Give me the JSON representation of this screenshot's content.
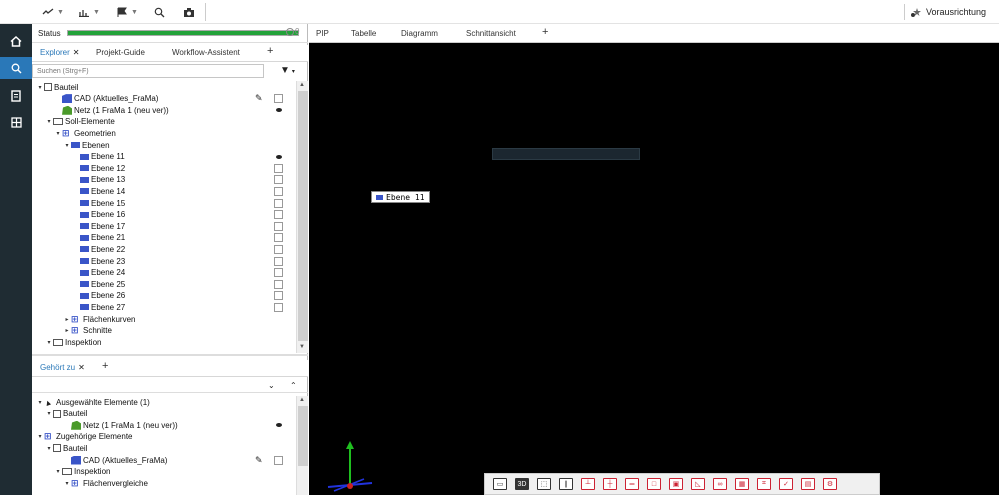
{
  "toolbar": {
    "buttons": [
      {
        "icon": "curve-icon"
      },
      {
        "icon": "chart-icon"
      },
      {
        "icon": "flag-icon"
      },
      {
        "icon": "search-icon"
      },
      {
        "icon": "camera-icon"
      }
    ],
    "align_label": "Vorausrichtung"
  },
  "leftbar": {
    "items": [
      {
        "icon": "home-icon"
      },
      {
        "icon": "search-icon",
        "active": true
      },
      {
        "icon": "document-icon"
      },
      {
        "icon": "grid-icon"
      }
    ]
  },
  "panel": {
    "status_label": "Status",
    "status_progress": 1.0,
    "status_count": "0",
    "tabs": [
      {
        "label": "Explorer",
        "selected": true,
        "closable": true
      },
      {
        "label": "Projekt-Guide"
      },
      {
        "label": "Workflow-Assistent"
      }
    ],
    "add_tab": "+",
    "search_placeholder": "Suchen (Strg+F)",
    "tree": [
      {
        "label": "Bauteil",
        "indent": 0,
        "icon": "box",
        "exp": "▾"
      },
      {
        "label": "CAD (Aktuelles_FraMa)",
        "indent": 2,
        "icon": "cad",
        "pencil": true,
        "check": "box"
      },
      {
        "label": "Netz (1 FraMa 1 (neu ver))",
        "indent": 2,
        "icon": "mesh",
        "check": "eye"
      },
      {
        "label": "Soll-Elemente",
        "indent": 1,
        "icon": "folder",
        "exp": "▾"
      },
      {
        "label": "Geometrien",
        "indent": 2,
        "icon": "geo",
        "exp": "▾"
      },
      {
        "label": "Ebenen",
        "indent": 3,
        "icon": "plane",
        "exp": "▾"
      },
      {
        "label": "Ebene 11",
        "indent": 4,
        "icon": "plane",
        "check": "eye"
      },
      {
        "label": "Ebene 12",
        "indent": 4,
        "icon": "plane",
        "check": "box"
      },
      {
        "label": "Ebene 13",
        "indent": 4,
        "icon": "plane",
        "check": "box"
      },
      {
        "label": "Ebene 14",
        "indent": 4,
        "icon": "plane",
        "check": "box"
      },
      {
        "label": "Ebene 15",
        "indent": 4,
        "icon": "plane",
        "check": "box"
      },
      {
        "label": "Ebene 16",
        "indent": 4,
        "icon": "plane",
        "check": "box"
      },
      {
        "label": "Ebene 17",
        "indent": 4,
        "icon": "plane",
        "check": "box"
      },
      {
        "label": "Ebene 21",
        "indent": 4,
        "icon": "plane",
        "check": "box"
      },
      {
        "label": "Ebene 22",
        "indent": 4,
        "icon": "plane",
        "check": "box"
      },
      {
        "label": "Ebene 23",
        "indent": 4,
        "icon": "plane",
        "check": "box"
      },
      {
        "label": "Ebene 24",
        "indent": 4,
        "icon": "plane",
        "check": "box"
      },
      {
        "label": "Ebene 25",
        "indent": 4,
        "icon": "plane",
        "check": "box"
      },
      {
        "label": "Ebene 26",
        "indent": 4,
        "icon": "plane",
        "check": "box"
      },
      {
        "label": "Ebene 27",
        "indent": 4,
        "icon": "plane",
        "check": "box"
      },
      {
        "label": "Flächenkurven",
        "indent": 3,
        "icon": "geo",
        "exp": "▸"
      },
      {
        "label": "Schnitte",
        "indent": 3,
        "icon": "geo",
        "exp": "▸"
      },
      {
        "label": "Inspektion",
        "indent": 1,
        "icon": "folder",
        "exp": "▾"
      }
    ],
    "lower_tabs": [
      {
        "label": "Gehört zu",
        "selected": true,
        "closable": true
      }
    ],
    "lower_add": "+",
    "lower_tree": [
      {
        "label": "Ausgewählte Elemente (1)",
        "indent": 0,
        "icon": "cursor",
        "exp": "▾"
      },
      {
        "label": "Bauteil",
        "indent": 1,
        "icon": "box",
        "exp": "▾"
      },
      {
        "label": "Netz (1 FraMa 1 (neu ver))",
        "indent": 3,
        "icon": "mesh",
        "check": "eye"
      },
      {
        "label": "Zugehörige Elemente",
        "indent": 0,
        "icon": "geo",
        "exp": "▾"
      },
      {
        "label": "Bauteil",
        "indent": 1,
        "icon": "box",
        "exp": "▾"
      },
      {
        "label": "CAD (Aktuelles_FraMa)",
        "indent": 3,
        "icon": "cad",
        "pencil": true,
        "check": "box"
      },
      {
        "label": "Inspektion",
        "indent": 2,
        "icon": "folder",
        "exp": "▾"
      },
      {
        "label": "Flächenvergleiche",
        "indent": 3,
        "icon": "geo",
        "exp": "▾"
      }
    ]
  },
  "main": {
    "tabs": [
      "PIP",
      "Tabelle",
      "Diagramm",
      "Schnittansicht"
    ],
    "add_tab": "+",
    "viewport_label": "Ebene 11",
    "bottom_toolbar": [
      "3D"
    ]
  }
}
